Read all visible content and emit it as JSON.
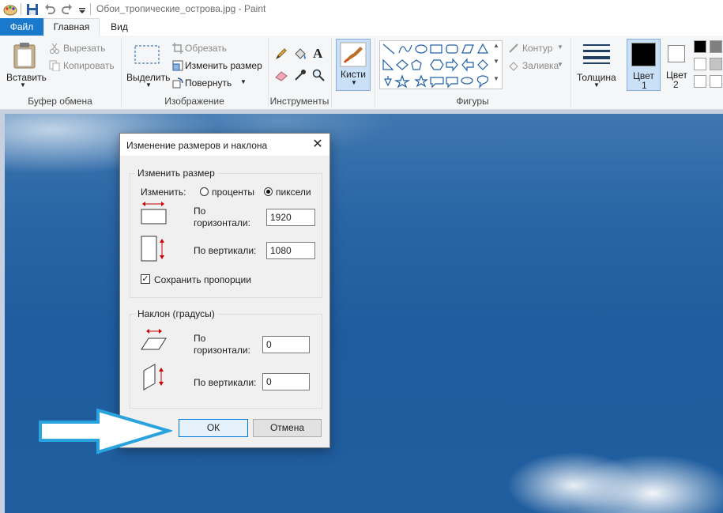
{
  "window": {
    "title": "Обои_тропические_острова.jpg - Paint"
  },
  "tabs": {
    "file": "Файл",
    "home": "Главная",
    "view": "Вид"
  },
  "ribbon": {
    "clipboard": {
      "paste": "Вставить",
      "cut": "Вырезать",
      "copy": "Копировать",
      "label": "Буфер обмена"
    },
    "image": {
      "select": "Выделить",
      "crop": "Обрезать",
      "resize": "Изменить размер",
      "rotate": "Повернуть",
      "label": "Изображение"
    },
    "tools": {
      "label": "Инструменты"
    },
    "brushes": {
      "label": "Кисти"
    },
    "shapes": {
      "outline": "Контур",
      "fill": "Заливка",
      "label": "Фигуры"
    },
    "size": {
      "label": "Толщина"
    },
    "color1": {
      "line1": "Цвет",
      "line2": "1",
      "value": "#000000"
    },
    "color2": {
      "line1": "Цвет",
      "line2": "2",
      "value": "#ffffff"
    },
    "palette": [
      "#000000",
      "#7f7f7f",
      "#ffffff",
      "#c3c3c3",
      "#ffffff",
      "#ffffff"
    ]
  },
  "dialog": {
    "title": "Изменение размеров и наклона",
    "resize": {
      "legend": "Изменить размер",
      "by_label": "Изменить:",
      "percent_label": "проценты",
      "pixels_label": "пиксели",
      "selected": "pixels",
      "horizontal_label_1": "По",
      "horizontal_label_2": "горизонтали:",
      "horizontal_value": "1920",
      "vertical_label": "По вертикали:",
      "vertical_value": "1080",
      "keep_ratio_label": "Сохранить пропорции",
      "keep_ratio_checked": true
    },
    "skew": {
      "legend": "Наклон (градусы)",
      "horizontal_label_1": "По",
      "horizontal_label_2": "горизонтали:",
      "horizontal_value": "0",
      "vertical_label": "По вертикали:",
      "vertical_value": "0"
    },
    "ok_label": "ОК",
    "cancel_label": "Отмена"
  },
  "annotation": {
    "arrow_color": "#29a3dd"
  }
}
